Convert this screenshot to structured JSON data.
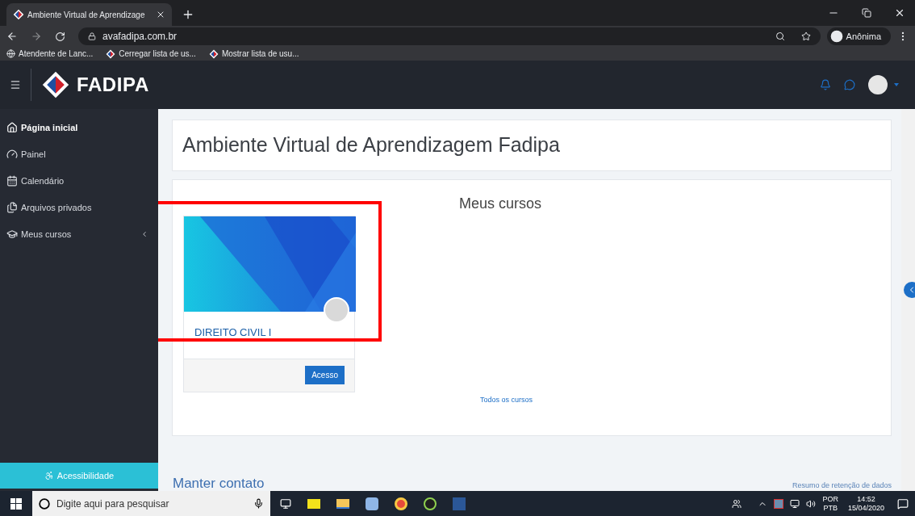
{
  "browser": {
    "tab_title": "Ambiente Virtual de Aprendizage",
    "address": "avafadipa.com.br",
    "profile": "Anônima",
    "bookmarks": [
      {
        "label": "Atendente de Lanc...",
        "kind": "globe"
      },
      {
        "label": "Cerregar lista de us...",
        "kind": "logo"
      },
      {
        "label": "Mostrar lista de usu...",
        "kind": "logo"
      }
    ]
  },
  "site": {
    "brand": "FADIPA"
  },
  "sidebar": {
    "items": [
      {
        "label": "Página inicial",
        "kind": "home",
        "selected": true
      },
      {
        "label": "Painel",
        "kind": "gauge",
        "selected": false
      },
      {
        "label": "Calendário",
        "kind": "calendar",
        "selected": false
      },
      {
        "label": "Arquivos privados",
        "kind": "files",
        "selected": false
      },
      {
        "label": "Meus cursos",
        "kind": "courses",
        "selected": false,
        "expanded": false
      }
    ],
    "accessibility": "Acessibilidade"
  },
  "page": {
    "title": "Ambiente Virtual de Aprendizagem Fadipa",
    "section_title": "Meus cursos",
    "courses": [
      {
        "name": "DIREITO CIVIL I",
        "button": "Acesso"
      }
    ],
    "all_courses_link": "Todos os cursos",
    "footer_heading": "Manter contato",
    "footer_link": "Resumo de retenção de dados"
  },
  "taskbar": {
    "search_placeholder": "Digite aqui para pesquisar",
    "language": "POR",
    "layout": "PTB",
    "time": "14:52",
    "date": "15/04/2020"
  }
}
